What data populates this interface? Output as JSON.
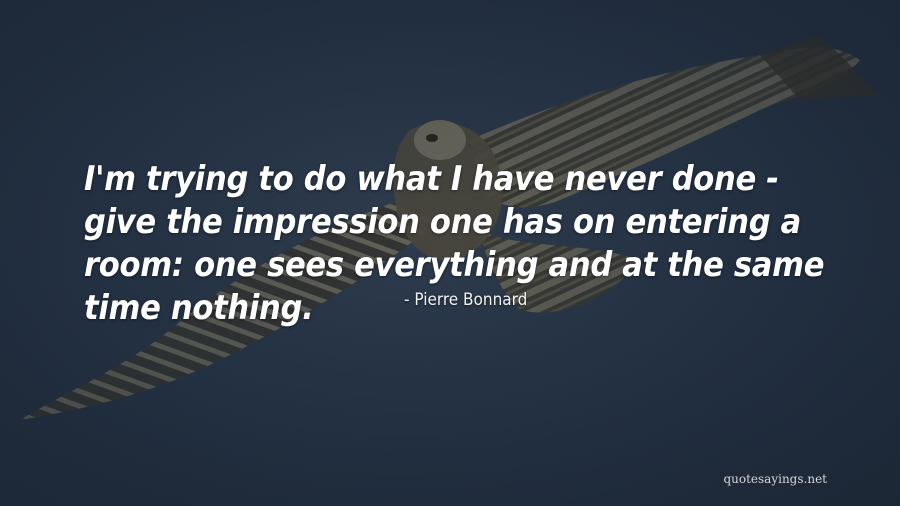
{
  "quote": {
    "text": "I'm trying to do what I have never done - give the impression one has on entering a room: one sees everything and at the same time nothing.",
    "author": "- Pierre Bonnard"
  },
  "watermark": "quotesayings.net",
  "background": {
    "subject": "osprey-in-flight",
    "sky_color": "#253345",
    "bird_dark": "#2b2a24",
    "bird_light": "#7d7a6a"
  }
}
